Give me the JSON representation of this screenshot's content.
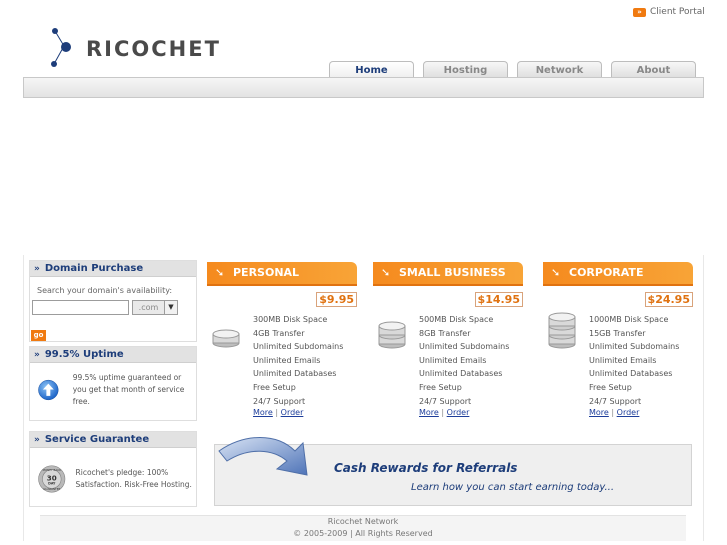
{
  "header": {
    "client_portal": "Client Portal",
    "logo_text": "RICOCHET"
  },
  "nav": {
    "tabs": [
      {
        "label": "Home",
        "active": true
      },
      {
        "label": "Hosting",
        "active": false
      },
      {
        "label": "Network",
        "active": false
      },
      {
        "label": "About",
        "active": false
      }
    ]
  },
  "sidebar": {
    "domain": {
      "title": "Domain Purchase",
      "label": "Search your domain's availability:",
      "input_value": "",
      "tld_selected": ".com",
      "go_label": "go"
    },
    "uptime": {
      "title": "99.5% Uptime",
      "text": "99.5% uptime guaranteed or you get that month of service free."
    },
    "guarantee": {
      "title": "Service Guarantee",
      "text": "Ricochet's pledge: 100% Satisfaction. Risk-Free Hosting.",
      "badge_top": "MONEY BACK",
      "badge_days": "30",
      "badge_day_word": "DAY",
      "badge_bottom": "GUARANTEE"
    }
  },
  "plans": [
    {
      "name": "PERSONAL",
      "price": "$9.95",
      "features": [
        "300MB Disk Space",
        "4GB Transfer",
        "Unlimited Subdomains",
        "Unlimited Emails",
        "Unlimited Databases",
        "Free Setup",
        "24/7 Support"
      ],
      "more": "More",
      "sep": "|",
      "order": "Order"
    },
    {
      "name": "SMALL BUSINESS",
      "price": "$14.95",
      "features": [
        "500MB Disk Space",
        "8GB Transfer",
        "Unlimited Subdomains",
        "Unlimited Emails",
        "Unlimited Databases",
        "Free Setup",
        "24/7 Support"
      ],
      "more": "More",
      "sep": "|",
      "order": "Order"
    },
    {
      "name": "CORPORATE",
      "price": "$24.95",
      "features": [
        "1000MB Disk Space",
        "15GB Transfer",
        "Unlimited Subdomains",
        "Unlimited Emails",
        "Unlimited Databases",
        "Free Setup",
        "24/7 Support"
      ],
      "more": "More",
      "sep": "|",
      "order": "Order"
    }
  ],
  "promo": {
    "title": "Cash Rewards for Referrals",
    "subtitle": "Learn how you can start earning today..."
  },
  "footer": {
    "line1": "Ricochet Network",
    "line2": "© 2005-2009 | All Rights Reserved"
  },
  "colors": {
    "accent_orange": "#f58a1e",
    "navy": "#1d3d7a",
    "link_blue": "#1d3d9a"
  }
}
